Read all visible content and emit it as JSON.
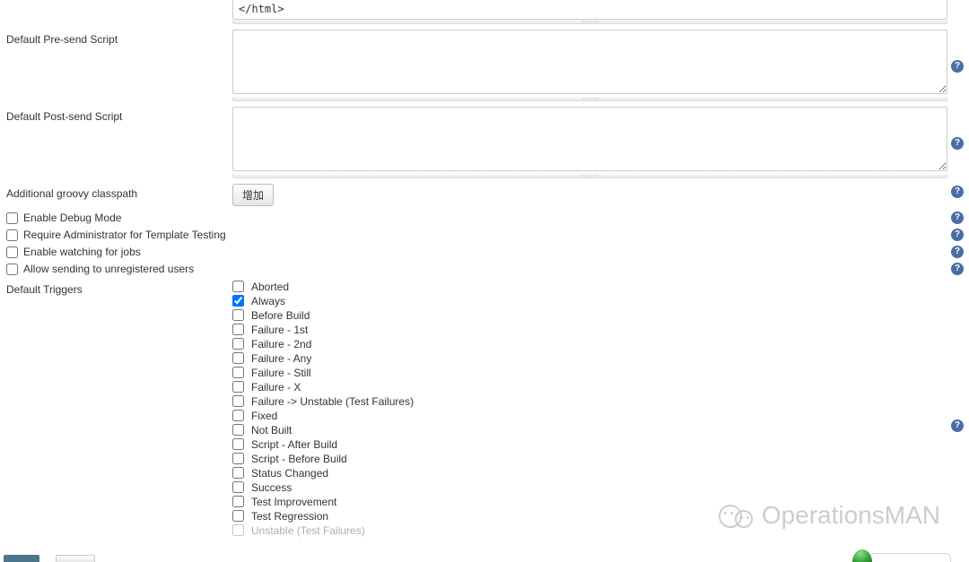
{
  "topSnippet": "</html>",
  "labels": {
    "preSend": "Default Pre-send Script",
    "postSend": "Default Post-send Script",
    "classpath": "Additional groovy classpath",
    "addButton": "增加",
    "enableDebug": "Enable Debug Mode",
    "requireAdmin": "Require Administrator for Template Testing",
    "watchJobs": "Enable watching for jobs",
    "allowUnregistered": "Allow sending to unregistered users",
    "defaultTriggers": "Default Triggers"
  },
  "options": {
    "enableDebug": false,
    "requireAdmin": false,
    "watchJobs": false,
    "allowUnregistered": false
  },
  "triggers": [
    {
      "label": "Aborted",
      "checked": false
    },
    {
      "label": "Always",
      "checked": true
    },
    {
      "label": "Before Build",
      "checked": false
    },
    {
      "label": "Failure - 1st",
      "checked": false
    },
    {
      "label": "Failure - 2nd",
      "checked": false
    },
    {
      "label": "Failure - Any",
      "checked": false
    },
    {
      "label": "Failure - Still",
      "checked": false
    },
    {
      "label": "Failure - X",
      "checked": false
    },
    {
      "label": "Failure -> Unstable (Test Failures)",
      "checked": false
    },
    {
      "label": "Fixed",
      "checked": false
    },
    {
      "label": "Not Built",
      "checked": false
    },
    {
      "label": "Script - After Build",
      "checked": false
    },
    {
      "label": "Script - Before Build",
      "checked": false
    },
    {
      "label": "Status Changed",
      "checked": false
    },
    {
      "label": "Success",
      "checked": false
    },
    {
      "label": "Test Improvement",
      "checked": false
    },
    {
      "label": "Test Regression",
      "checked": false
    },
    {
      "label": "Unstable (Test Failures)",
      "checked": false
    }
  ],
  "helpGlyph": "?",
  "watermark": "OperationsMAN"
}
